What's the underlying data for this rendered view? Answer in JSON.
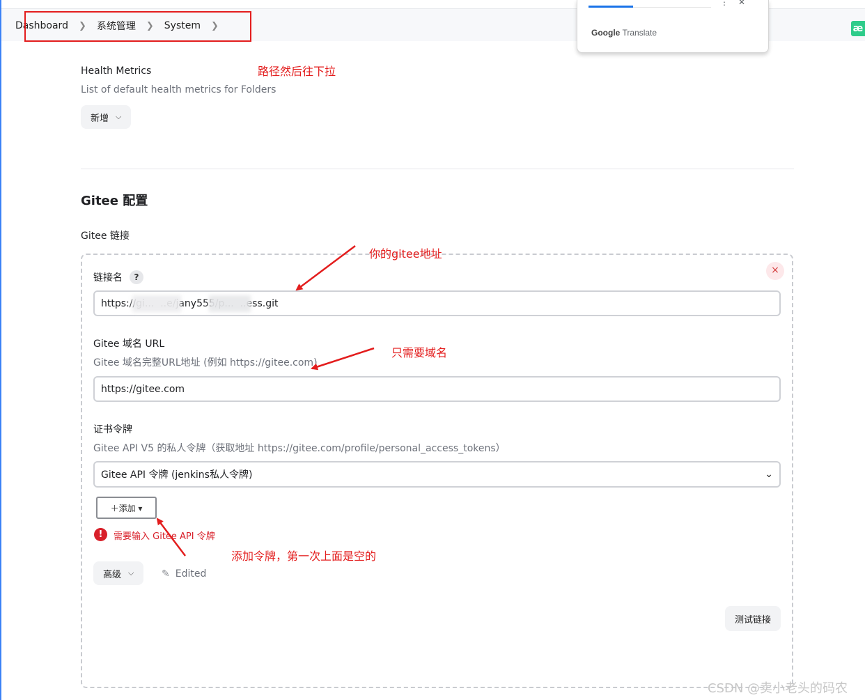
{
  "breadcrumb": {
    "items": [
      "Dashboard",
      "系统管理",
      "System"
    ]
  },
  "translate_popup": {
    "brand_google": "Google",
    "brand_translate": "Translate"
  },
  "side_badge": "æ",
  "health_metrics": {
    "title": "Health Metrics",
    "description": "List of default health metrics for Folders",
    "add_button": "新增"
  },
  "gitee": {
    "section_title": "Gitee 配置",
    "connections_label": "Gitee 链接",
    "connection_name_label": "链接名",
    "help_symbol": "?",
    "connection_name_value": "https://gi...  ..e/jany555/p...  ..ess.git",
    "domain_label": "Gitee 域名 URL",
    "domain_description": "Gitee 域名完整URL地址 (例如 https://gitee.com)",
    "domain_value": "https://gitee.com",
    "credential_label": "证书令牌",
    "credential_description": "Gitee API V5 的私人令牌（获取地址 https://gitee.com/profile/personal_access_tokens）",
    "credential_selected": "Gitee API 令牌 (jenkins私人令牌)",
    "add_button": "＋添加 ▾",
    "error_symbol": "!",
    "error_message": "需要输入 Gitee API 令牌",
    "advanced_button": "高级",
    "edited_label": "Edited",
    "test_button": "测试链接",
    "close_symbol": "×"
  },
  "annotations": {
    "breadcrumb_note": "路径然后往下拉",
    "address_note": "你的gitee地址",
    "domain_note": "只需要域名",
    "token_note": "添加令牌，第一次上面是空的"
  },
  "watermark": "CSDN @卖小老头的码农",
  "colors": {
    "annotation_red": "#e31d1d",
    "error_red": "#d8202a",
    "accent_blue": "#1a73e8",
    "badge_green": "#2ecc8a"
  }
}
